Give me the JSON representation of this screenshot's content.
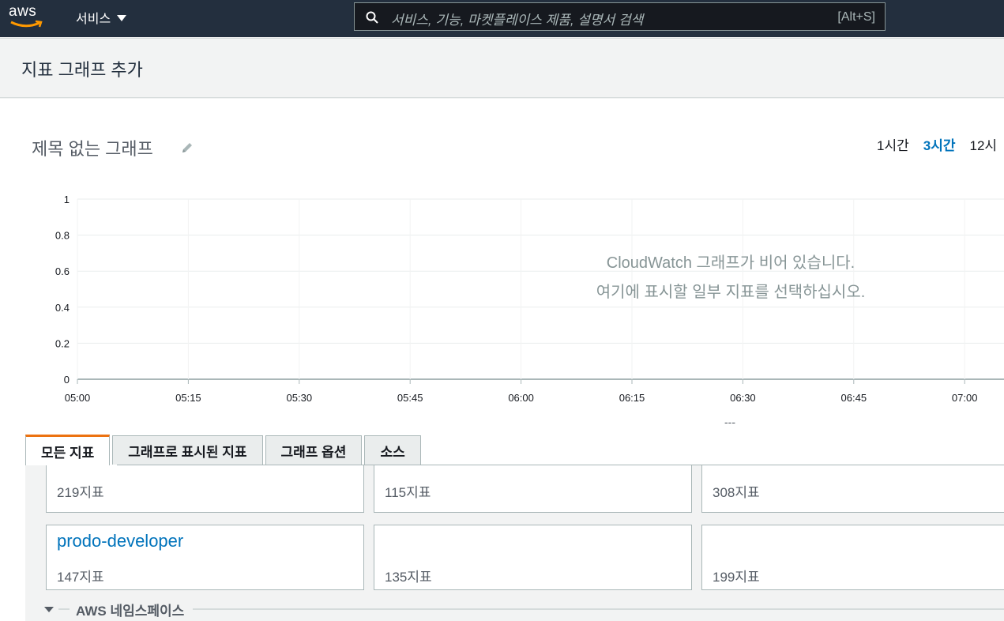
{
  "topbar": {
    "logo": "aws",
    "services_label": "서비스",
    "search_placeholder": "서비스, 기능, 마켓플레이스 제품, 설명서 검색",
    "search_shortcut": "[Alt+S]"
  },
  "header": {
    "page_title": "지표 그래프 추가"
  },
  "graph": {
    "title": "제목 없는 그래프",
    "time_ranges": [
      {
        "label": "1시간",
        "active": false
      },
      {
        "label": "3시간",
        "active": true
      },
      {
        "label": "12시",
        "active": false
      }
    ],
    "empty_line1": "CloudWatch 그래프가 비어 있습니다.",
    "empty_line2": "여기에 표시할 일부 지표를 선택하십시오.",
    "legend_placeholder": "---"
  },
  "chart_data": {
    "type": "line",
    "title": "제목 없는 그래프",
    "xlabel": "",
    "ylabel": "",
    "x_ticks": [
      "05:00",
      "05:15",
      "05:30",
      "05:45",
      "06:00",
      "06:15",
      "06:30",
      "06:45",
      "07:00"
    ],
    "y_ticks": [
      "0",
      "0.2",
      "0.4",
      "0.6",
      "0.8",
      "1"
    ],
    "ylim": [
      0,
      1
    ],
    "series": [],
    "grid": true
  },
  "tabs": [
    {
      "label": "모든 지표",
      "active": true
    },
    {
      "label": "그래프로 표시된 지표",
      "active": false
    },
    {
      "label": "그래프 옵션",
      "active": false
    },
    {
      "label": "소스",
      "active": false
    }
  ],
  "metric_cards": {
    "row1": [
      {
        "name": "",
        "count": "219지표"
      },
      {
        "name": "",
        "count": "115지표"
      },
      {
        "name": "",
        "count": "308지표"
      }
    ],
    "row2": [
      {
        "name": "prodo-developer",
        "count": "147지표"
      },
      {
        "name": "",
        "count": "135지표"
      },
      {
        "name": "",
        "count": "199지표"
      }
    ]
  },
  "namespace": {
    "label": "AWS 네임스페이스"
  },
  "colors": {
    "accent": "#0073bb",
    "tab_active": "#ec7211",
    "topbar": "#232f3e"
  },
  "icons": {
    "search": "search-icon",
    "edit": "pencil-icon",
    "caret": "caret-down-icon"
  }
}
